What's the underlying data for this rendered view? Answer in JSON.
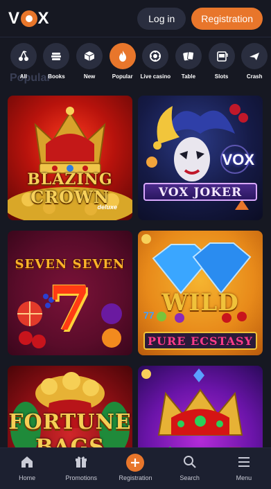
{
  "header": {
    "logo_text_v": "V",
    "logo_text_x": "X",
    "login_label": "Log in",
    "registration_label": "Registration"
  },
  "categories": [
    {
      "label": "All",
      "icon": "cherries-icon",
      "active": false
    },
    {
      "label": "Books",
      "icon": "books-icon",
      "active": false
    },
    {
      "label": "New",
      "icon": "cube-icon",
      "active": false
    },
    {
      "label": "Popular",
      "icon": "fire-icon",
      "active": true
    },
    {
      "label": "Live casino",
      "icon": "chip-icon",
      "active": false
    },
    {
      "label": "Table",
      "icon": "cards-icon",
      "active": false
    },
    {
      "label": "Slots",
      "icon": "slot-machine-icon",
      "active": false
    },
    {
      "label": "Crash",
      "icon": "plane-icon",
      "active": false
    }
  ],
  "section_title": "Popular",
  "games": [
    {
      "title": "BLAZING",
      "title2": "CROWN",
      "sub": "deluxe"
    },
    {
      "title": "VOX JOKER",
      "badge": "VOX"
    },
    {
      "title": "SEVEN SEVEN",
      "digit": "7"
    },
    {
      "title": "WILD",
      "title2": "PURE ECSTASY",
      "digits": "77"
    },
    {
      "title": "FORTUNE",
      "title2": "BAGS"
    },
    {
      "title": "",
      "title2": ""
    }
  ],
  "bottom_nav": [
    {
      "label": "Home",
      "icon": "home-icon"
    },
    {
      "label": "Promotions",
      "icon": "gift-icon"
    },
    {
      "label": "Registration",
      "icon": "plus-icon"
    },
    {
      "label": "Search",
      "icon": "search-icon"
    },
    {
      "label": "Menu",
      "icon": "menu-icon"
    }
  ],
  "colors": {
    "accent": "#e8762b",
    "background": "#161822",
    "pill": "#2a2e3f"
  }
}
